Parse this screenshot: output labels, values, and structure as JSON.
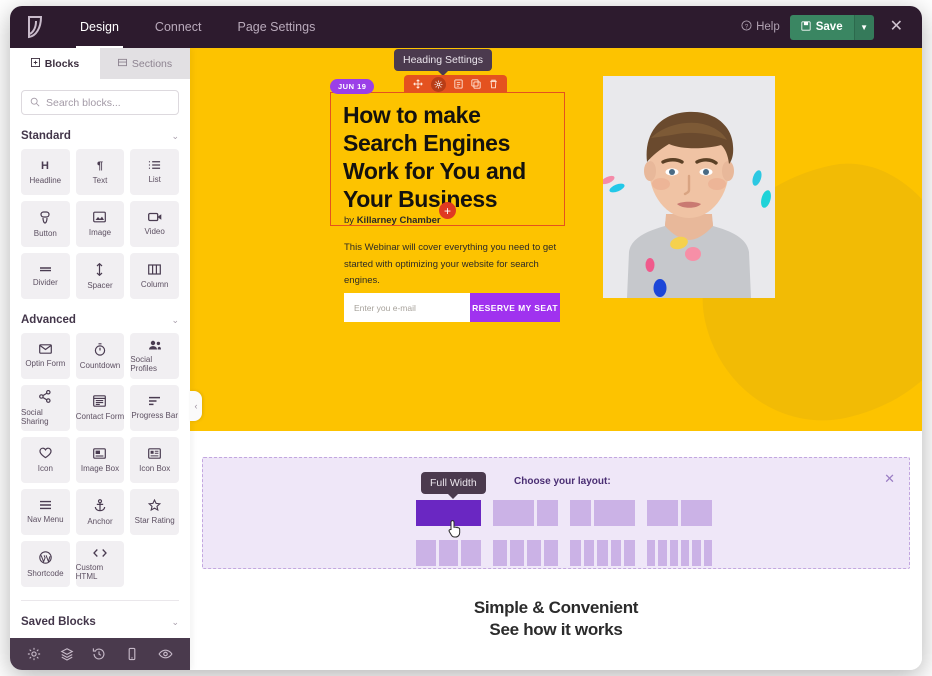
{
  "app": {
    "logo_icon": "leaf-logo-icon",
    "nav": [
      {
        "label": "Design",
        "active": true
      },
      {
        "label": "Connect",
        "active": false
      },
      {
        "label": "Page Settings",
        "active": false
      }
    ],
    "help_label": "Help",
    "save_label": "Save",
    "save_caret_icon": "chevron-down-icon",
    "close_icon": "close-icon",
    "colors": {
      "topbar": "#2d1b2e",
      "save_green": "#3a8662",
      "hero_yellow": "#fdc300",
      "toolbar_orange": "#e4521f",
      "accent_purple": "#a032ef",
      "picker_purple": "#6a27c2"
    }
  },
  "sidebar": {
    "tabs": [
      {
        "label": "Blocks",
        "icon": "blocks-icon",
        "active": true
      },
      {
        "label": "Sections",
        "icon": "sections-icon",
        "active": false
      }
    ],
    "search": {
      "placeholder": "Search blocks...",
      "value": "",
      "icon": "search-icon"
    },
    "sections": [
      {
        "title": "Standard",
        "chevron": "chevron-down-icon",
        "blocks": [
          {
            "label": "Headline",
            "icon": "headline-icon"
          },
          {
            "label": "Text",
            "icon": "paragraph-icon"
          },
          {
            "label": "List",
            "icon": "list-icon"
          },
          {
            "label": "Button",
            "icon": "button-icon"
          },
          {
            "label": "Image",
            "icon": "image-icon"
          },
          {
            "label": "Video",
            "icon": "video-icon"
          },
          {
            "label": "Divider",
            "icon": "divider-icon"
          },
          {
            "label": "Spacer",
            "icon": "spacer-icon"
          },
          {
            "label": "Column",
            "icon": "column-icon"
          }
        ]
      },
      {
        "title": "Advanced",
        "chevron": "chevron-down-icon",
        "blocks": [
          {
            "label": "Optin Form",
            "icon": "envelope-icon"
          },
          {
            "label": "Countdown",
            "icon": "stopwatch-icon"
          },
          {
            "label": "Social Profiles",
            "icon": "people-icon"
          },
          {
            "label": "Social Sharing",
            "icon": "share-icon"
          },
          {
            "label": "Contact Form",
            "icon": "form-icon"
          },
          {
            "label": "Progress Bar",
            "icon": "progress-bar-icon"
          },
          {
            "label": "Icon",
            "icon": "heart-icon"
          },
          {
            "label": "Image Box",
            "icon": "image-box-icon"
          },
          {
            "label": "Icon Box",
            "icon": "icon-box-icon"
          },
          {
            "label": "Nav Menu",
            "icon": "hamburger-icon"
          },
          {
            "label": "Anchor",
            "icon": "anchor-icon"
          },
          {
            "label": "Star Rating",
            "icon": "star-icon"
          },
          {
            "label": "Shortcode",
            "icon": "wordpress-icon"
          },
          {
            "label": "Custom HTML",
            "icon": "code-icon"
          }
        ]
      }
    ],
    "saved_blocks": {
      "title": "Saved Blocks",
      "chevron": "chevron-down-icon"
    },
    "bottom_icons": [
      "gear-icon",
      "layers-icon",
      "history-icon",
      "mobile-icon",
      "eye-preview-icon"
    ],
    "collapse_icon": "chevron-left-icon"
  },
  "canvas": {
    "heading_tooltip": "Heading Settings",
    "block_toolbar_icons": [
      "move-icon",
      "gear-icon",
      "save-block-icon",
      "duplicate-icon",
      "trash-icon"
    ],
    "date_badge": "JUN 19",
    "headline": "How to make Search Engines Work for You and Your Business",
    "add_block_icon": "plus-circle-icon",
    "byline_prefix": "by",
    "byline_name": "Killarney Chamber",
    "subcopy": "This Webinar will cover everything you need to get started with optimizing your website for search engines.",
    "email_placeholder": "Enter you e-mail",
    "email_value": "",
    "cta_label": "RESERVE MY SEAT",
    "photo_alt": "portrait-photo"
  },
  "layout_picker": {
    "tooltip": "Full Width",
    "title": "Choose your layout:",
    "close_icon": "close-icon",
    "cursor_icon": "hand-pointer-cursor",
    "options": [
      {
        "name": "full-width",
        "columns": [
          1
        ],
        "selected": true
      },
      {
        "name": "two-col-wide-narrow",
        "columns": [
          2,
          1
        ],
        "selected": false
      },
      {
        "name": "two-col-narrow-wide",
        "columns": [
          1,
          2
        ],
        "selected": false
      },
      {
        "name": "two-col-equal",
        "columns": [
          1,
          1
        ],
        "selected": false
      },
      {
        "name": "three-col",
        "columns": [
          1,
          1,
          1
        ],
        "selected": false
      },
      {
        "name": "four-col",
        "columns": [
          1,
          1,
          1,
          1
        ],
        "selected": false
      },
      {
        "name": "five-col",
        "columns": [
          1,
          1,
          1,
          1,
          1
        ],
        "selected": false
      },
      {
        "name": "six-col",
        "columns": [
          1,
          1,
          1,
          1,
          1,
          1
        ],
        "selected": false
      }
    ]
  },
  "footer_section": {
    "line1": "Simple & Convenient",
    "line2": "See how it works"
  }
}
